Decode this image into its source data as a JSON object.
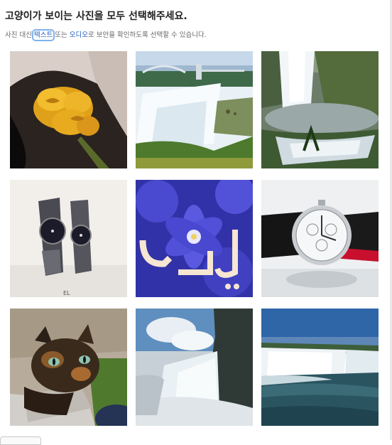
{
  "challenge": {
    "title": "고양이가 보이는 사진을 모두 선택해주세요.",
    "instruction_prefix": "사진 대신 ",
    "text_link": "텍스트",
    "instruction_mid": " 또는 ",
    "audio_link": "오디오",
    "instruction_suffix": "로 보안을 확인하도록 선택할 수 있습니다."
  },
  "tiles": [
    {
      "subject": "yellow-roses"
    },
    {
      "subject": "waterfall-with-bridge"
    },
    {
      "subject": "waterfall-with-pool"
    },
    {
      "subject": "pair-of-watches"
    },
    {
      "subject": "blue-flowers-with-arabic-calligraphy"
    },
    {
      "subject": "wristwatch-with-leather-strap"
    },
    {
      "subject": "tortoiseshell-cat"
    },
    {
      "subject": "waterfall-mist"
    },
    {
      "subject": "waterfall-and-river"
    }
  ]
}
